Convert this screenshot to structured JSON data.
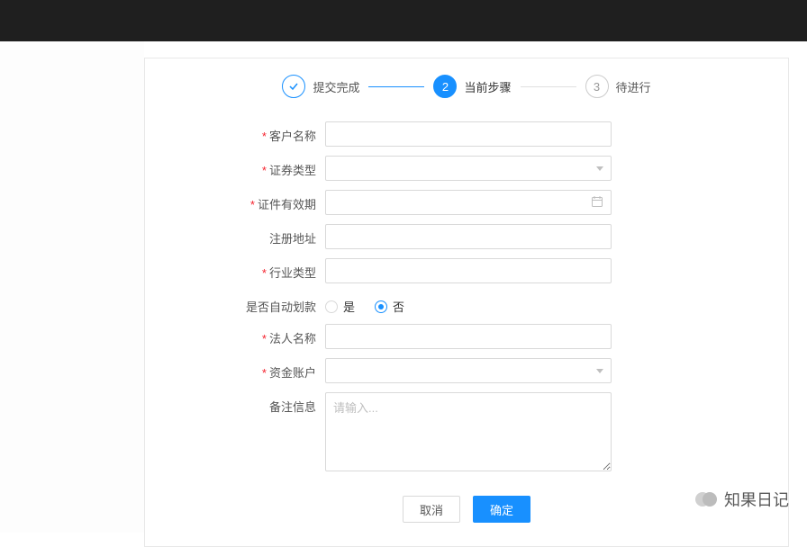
{
  "steps": {
    "done": {
      "label": "提交完成"
    },
    "current": {
      "num": "2",
      "label": "当前步骤"
    },
    "wait": {
      "num": "3",
      "label": "待进行"
    }
  },
  "form": {
    "customerName": {
      "label": "客户名称",
      "value": ""
    },
    "securityType": {
      "label": "证券类型",
      "value": ""
    },
    "validDate": {
      "label": "证件有效期",
      "value": ""
    },
    "regAddress": {
      "label": "注册地址",
      "value": ""
    },
    "industryType": {
      "label": "行业类型",
      "value": ""
    },
    "autoDeduct": {
      "label": "是否自动划款",
      "options": {
        "yes": "是",
        "no": "否"
      },
      "value": "no"
    },
    "legalName": {
      "label": "法人名称",
      "value": ""
    },
    "fundAccount": {
      "label": "资金账户",
      "value": ""
    },
    "remark": {
      "label": "备注信息",
      "placeholder": "请输入...",
      "value": ""
    }
  },
  "actions": {
    "cancel": "取消",
    "ok": "确定"
  },
  "watermark": "知果日记"
}
